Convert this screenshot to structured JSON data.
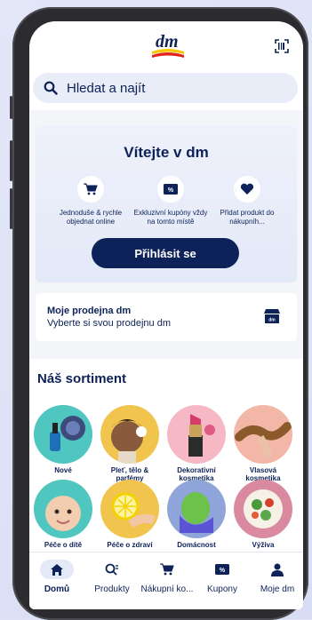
{
  "header": {
    "logo_text": "dm",
    "scan_icon": "barcode-scan-icon"
  },
  "search": {
    "placeholder": "Hledat a najít",
    "icon": "search-icon"
  },
  "welcome": {
    "title": "Vítejte v dm",
    "features": [
      {
        "icon": "cart-icon",
        "caption": "Jednoduše & rychle objednat online"
      },
      {
        "icon": "coupon-icon",
        "caption": "Exkluzivní kupóny vždy na tomto místě"
      },
      {
        "icon": "heart-icon",
        "caption": "Přidat produkt do nákupníh..."
      }
    ],
    "login_label": "Přihlásit se"
  },
  "store": {
    "title": "Moje prodejna dm",
    "subtitle": "Vyberte si svou prodejnu dm",
    "icon": "store-icon"
  },
  "assortment": {
    "title": "Náš sortiment",
    "categories": [
      {
        "label": "Nové",
        "icon": "nail-polish-icon"
      },
      {
        "label": "Pleť, tělo & parfémy",
        "icon": "face-care-icon"
      },
      {
        "label": "Dekorativní kosmetika",
        "icon": "lipstick-icon"
      },
      {
        "label": "Vlasová kosmetika",
        "icon": "hair-icon"
      },
      {
        "label": "Péče o dítě",
        "icon": "baby-icon"
      },
      {
        "label": "Péče o zdraví",
        "icon": "lemon-icon"
      },
      {
        "label": "Domácnost",
        "icon": "sponge-icon"
      },
      {
        "label": "Výživa",
        "icon": "salad-icon"
      }
    ]
  },
  "tabs": [
    {
      "label": "Domů",
      "icon": "home-icon",
      "active": true
    },
    {
      "label": "Produkty",
      "icon": "products-search-icon",
      "active": false
    },
    {
      "label": "Nákupní ko...",
      "icon": "cart-icon",
      "active": false
    },
    {
      "label": "Kupony",
      "icon": "coupon-icon",
      "active": false
    },
    {
      "label": "Moje dm",
      "icon": "user-icon",
      "active": false
    }
  ],
  "colors": {
    "brand_navy": "#0d2258",
    "brand_red": "#e2231a",
    "brand_yellow": "#f7c600",
    "screen_bg": "#f4f5f9"
  }
}
